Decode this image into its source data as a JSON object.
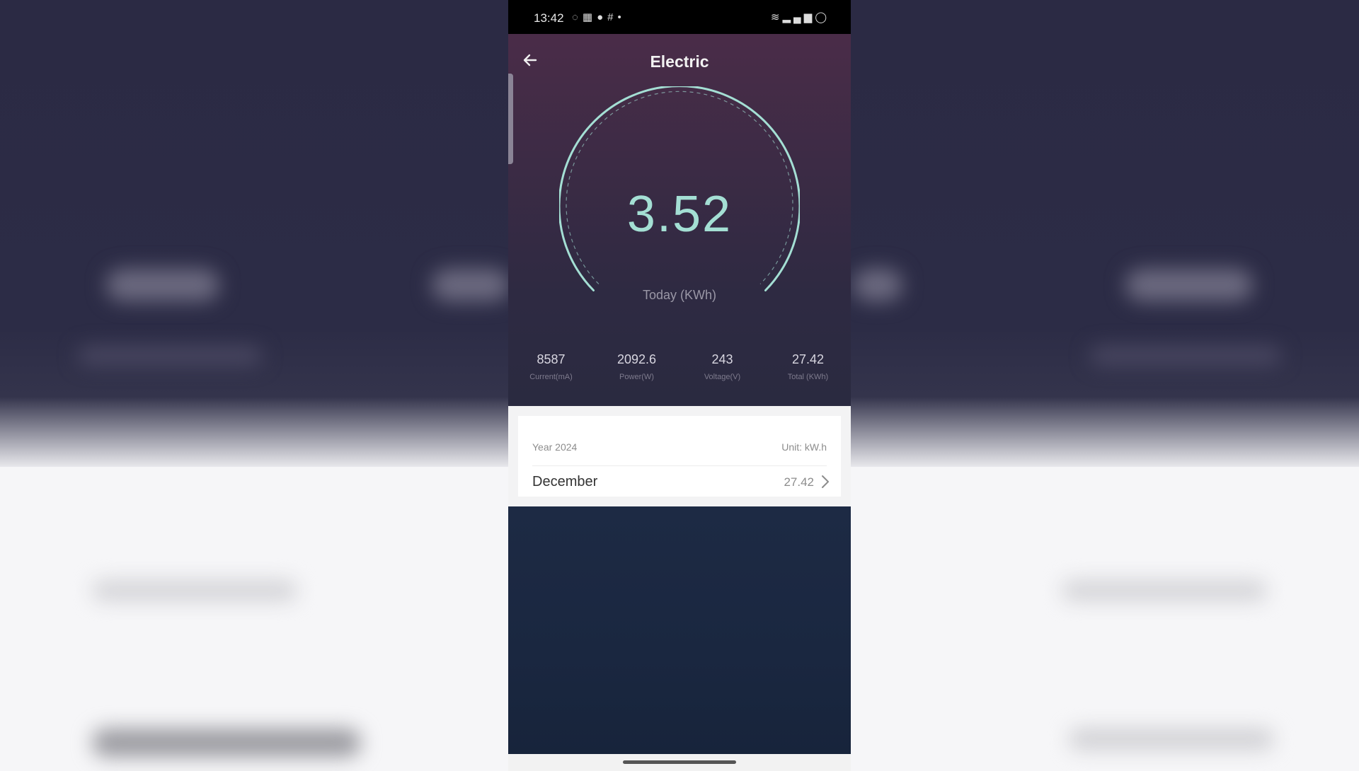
{
  "status_bar": {
    "time": "13:42",
    "left_icons": [
      "whatsapp-icon",
      "photos-icon",
      "chat-icon",
      "slack-icon",
      "dot-icon"
    ],
    "right_icons": [
      "data-speed-icon",
      "wifi-icon",
      "volte-icon",
      "signal-icon",
      "battery-icon"
    ]
  },
  "header": {
    "title": "Electric",
    "back_icon": "arrow-left-icon"
  },
  "gauge": {
    "value": "3.52",
    "label": "Today (KWh)",
    "color": "#a4dfd4"
  },
  "stats": [
    {
      "value": "8587",
      "label": "Current(mA)"
    },
    {
      "value": "2092.6",
      "label": "Power(W)"
    },
    {
      "value": "243",
      "label": "Voltage(V)"
    },
    {
      "value": "27.42",
      "label": "Total (KWh)"
    }
  ],
  "history": {
    "year_label": "Year 2024",
    "unit_label": "Unit: kW.h",
    "months": [
      {
        "name": "December",
        "value": "27.42"
      }
    ]
  },
  "colors": {
    "hero_top": "#4a2c48",
    "hero_bottom": "#2a2a40",
    "lower_panel": "#1d2a44"
  }
}
